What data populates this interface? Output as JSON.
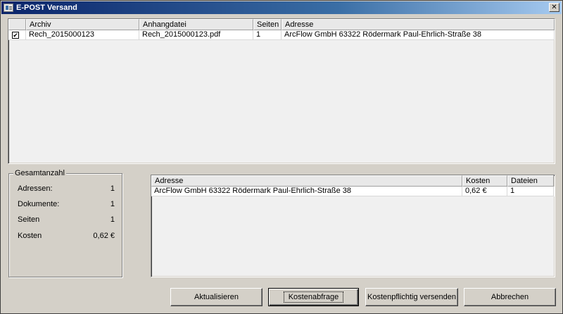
{
  "window": {
    "title": "E-POST Versand",
    "close_label": "✕"
  },
  "documents_table": {
    "columns": [
      "",
      "Archiv",
      "Anhangdatei",
      "Seiten",
      "Adresse"
    ],
    "rows": [
      {
        "checked": "✔",
        "archiv": "Rech_2015000123",
        "anhangdatei": "Rech_2015000123.pdf",
        "seiten": "1",
        "adresse": "ArcFlow GmbH 63322 Rödermark Paul-Ehrlich-Straße 38"
      }
    ]
  },
  "summary": {
    "title": "Gesamtanzahl",
    "items": [
      {
        "label": "Adressen:",
        "value": "1"
      },
      {
        "label": "Dokumente:",
        "value": "1"
      },
      {
        "label": "Seiten",
        "value": "1"
      },
      {
        "label": "Kosten",
        "value": "0,62 €"
      }
    ]
  },
  "cost_table": {
    "columns": [
      "Adresse",
      "Kosten",
      "Dateien"
    ],
    "rows": [
      {
        "adresse": "ArcFlow GmbH 63322 Rödermark Paul-Ehrlich-Straße 38",
        "kosten": "0,62 €",
        "dateien": "1"
      }
    ]
  },
  "buttons": {
    "aktualisieren": "Aktualisieren",
    "kostenabfrage": "Kostenabfrage",
    "versenden": "Kostenpflichtig versenden",
    "abbrechen": "Abbrechen"
  }
}
